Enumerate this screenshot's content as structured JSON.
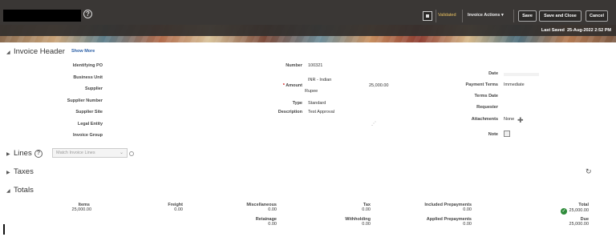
{
  "topbar": {
    "validated": "Validated",
    "invoice_actions": "Invoice Actions",
    "save": "Save",
    "save_and_close": "Save and Close",
    "cancel": "Cancel",
    "last_saved_label": "Last Saved",
    "last_saved_value": "25-Aug-2022 2:52 PM"
  },
  "header": {
    "title": "Invoice Header",
    "show_more": "Show More",
    "left_labels": [
      "Identifying PO",
      "Business Unit",
      "Supplier",
      "Supplier Number",
      "Supplier Site",
      "Legal Entity",
      "Invoice Group"
    ],
    "number_label": "Number",
    "number_value": "100321",
    "amount_label": "Amount",
    "currency_line1": "INR - Indian",
    "currency_line2": "Rupee",
    "amount_value": "25,000.00",
    "type_label": "Type",
    "type_value": "Standard",
    "description_label": "Description",
    "description_value": "Test Approval",
    "date_label": "Date",
    "payment_terms_label": "Payment Terms",
    "payment_terms_value": "Immediate",
    "terms_date_label": "Terms Date",
    "requester_label": "Requester",
    "attachments_label": "Attachments",
    "attachments_value": "None",
    "note_label": "Note"
  },
  "lines": {
    "title": "Lines",
    "match_placeholder": "Match Invoice Lines"
  },
  "taxes": {
    "title": "Taxes"
  },
  "totals": {
    "title": "Totals",
    "items_label": "Items",
    "items_value": "25,000.00",
    "freight_label": "Freight",
    "freight_value": "0.00",
    "misc_label": "Miscellaneous",
    "misc_value": "0.00",
    "tax_label": "Tax",
    "tax_value": "0.00",
    "incl_prepay_label": "Included Prepayments",
    "incl_prepay_value": "0.00",
    "total_label": "Total",
    "total_value": "25,000.00",
    "retainage_label": "Retainage",
    "retainage_value": "0.00",
    "withholding_label": "Withholding",
    "withholding_value": "0.00",
    "applied_prepay_label": "Applied Prepayments",
    "applied_prepay_value": "0.00",
    "due_label": "Due",
    "due_value": "25,000.00"
  },
  "colors": {
    "topbar": "#3a3735",
    "accent_validated": "#e8c060",
    "link": "#2b5fa6",
    "check": "#2e8b3a"
  },
  "icons": [
    "help-icon",
    "square-icon",
    "chevron-down-icon",
    "plus-icon",
    "note-icon",
    "refresh-icon",
    "check-icon"
  ]
}
